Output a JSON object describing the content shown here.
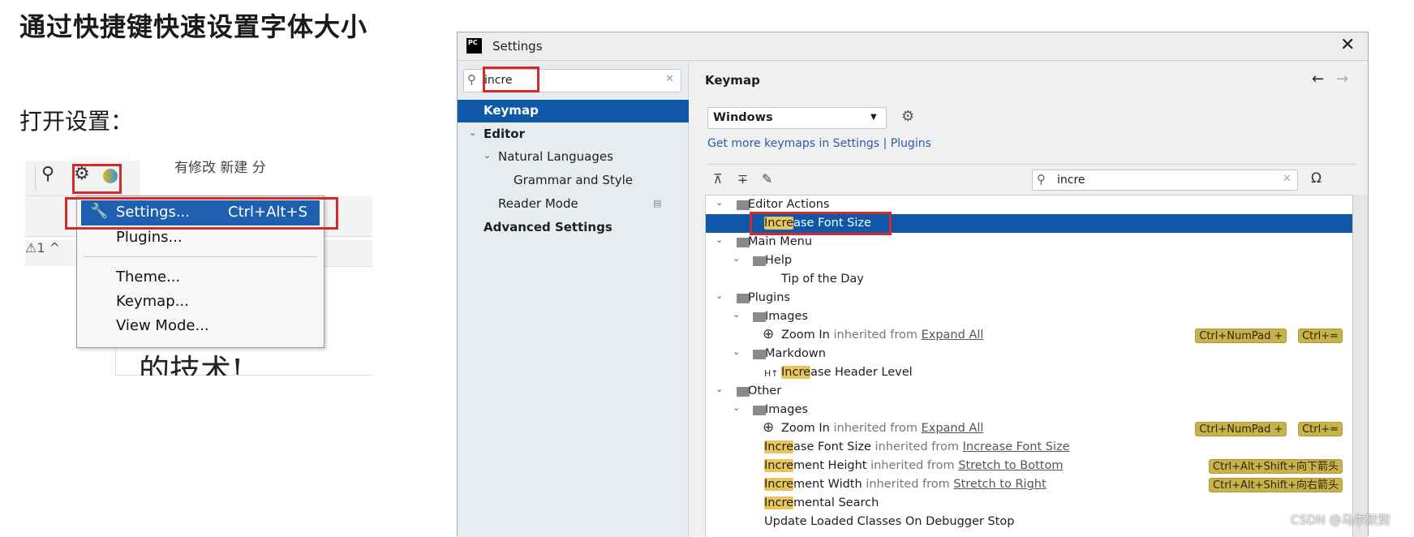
{
  "page": {
    "title": "通过快捷键快速设置字体大小",
    "subtitle": "打开设置："
  },
  "ide_crop": {
    "background_toolbar_text": "有修改   新建   分",
    "warning_count": "⚠1 ^",
    "editor_text": "的技术!",
    "menu": {
      "items": [
        {
          "label": "Settings...",
          "shortcut": "Ctrl+Alt+S",
          "icon": "wrench-icon",
          "selected": true
        },
        {
          "label": "Plugins..."
        },
        {
          "label": "Theme..."
        },
        {
          "label": "Keymap..."
        },
        {
          "label": "View Mode..."
        }
      ]
    }
  },
  "dialog": {
    "title": "Settings",
    "app_icon_text": "PC",
    "search": {
      "value": "incre"
    },
    "sidebar": [
      {
        "label": "Keymap",
        "selected": true,
        "bold": true
      },
      {
        "label": "Editor",
        "bold": true,
        "chevron": "expanded"
      },
      {
        "label": "Natural Languages",
        "chevron": "expanded"
      },
      {
        "label": "Grammar and Style"
      },
      {
        "label": "Reader Mode"
      },
      {
        "label": "Advanced Settings",
        "bold": true
      }
    ],
    "header": "Keymap",
    "keymap_select": "Windows",
    "link_text": "Get more keymaps in Settings | Plugins",
    "filter": {
      "value": "incre"
    },
    "tree": [
      {
        "depth": 0,
        "icon": "editor-actions-icon",
        "text": "Editor Actions"
      },
      {
        "depth": 2,
        "hl": "Incre",
        "text": "ase Font Size",
        "selected": true
      },
      {
        "depth": 0,
        "icon": "main-menu-icon",
        "text": "Main Menu"
      },
      {
        "depth": 1,
        "icon": "folder-icon",
        "text": "Help"
      },
      {
        "depth": 3,
        "text": "Tip of the Day"
      },
      {
        "depth": 0,
        "icon": "folder-icon",
        "text": "Plugins"
      },
      {
        "depth": 1,
        "icon": "folder-icon",
        "text": "Images"
      },
      {
        "depth": 2,
        "icon": "zoom-in-icon",
        "text": "Zoom In",
        "inherited": " inherited from ",
        "link": "Expand All",
        "shortcuts": [
          "Ctrl+NumPad +",
          "Ctrl+="
        ]
      },
      {
        "depth": 1,
        "icon": "folder-icon",
        "text": "Markdown"
      },
      {
        "depth": 2,
        "icon": "header-level-icon",
        "hl": "Incre",
        "text": "ase Header Level"
      },
      {
        "depth": 0,
        "icon": "other-icon",
        "text": "Other"
      },
      {
        "depth": 1,
        "icon": "folder-icon",
        "text": "Images"
      },
      {
        "depth": 2,
        "icon": "zoom-in-icon",
        "text": "Zoom In",
        "inherited": " inherited from ",
        "link": "Expand All",
        "shortcuts": [
          "Ctrl+NumPad +",
          "Ctrl+="
        ]
      },
      {
        "depth": 2,
        "hl": "Incre",
        "text": "ase Font Size",
        "inherited": " inherited from ",
        "link": "Increase Font Size"
      },
      {
        "depth": 2,
        "hl": "Incre",
        "text": "ment Height",
        "inherited": " inherited from ",
        "link": "Stretch to Bottom",
        "shortcuts": [
          "Ctrl+Alt+Shift+向下箭头"
        ]
      },
      {
        "depth": 2,
        "hl": "Incre",
        "text": "ment Width",
        "inherited": " inherited from ",
        "link": "Stretch to Right",
        "shortcuts": [
          "Ctrl+Alt+Shift+向右箭头"
        ]
      },
      {
        "depth": 2,
        "hl": "Incre",
        "text": "mental Search"
      },
      {
        "depth": 2,
        "text": "Update Loaded Classes On Debugger Stop"
      }
    ]
  },
  "watermark": "CSDN @马尔默契",
  "colors": {
    "selection": "#0f58a8",
    "highlight": "#e9c65a",
    "shortcut_badge": "#c9b24a",
    "annotation_box": "#d42a2a"
  }
}
